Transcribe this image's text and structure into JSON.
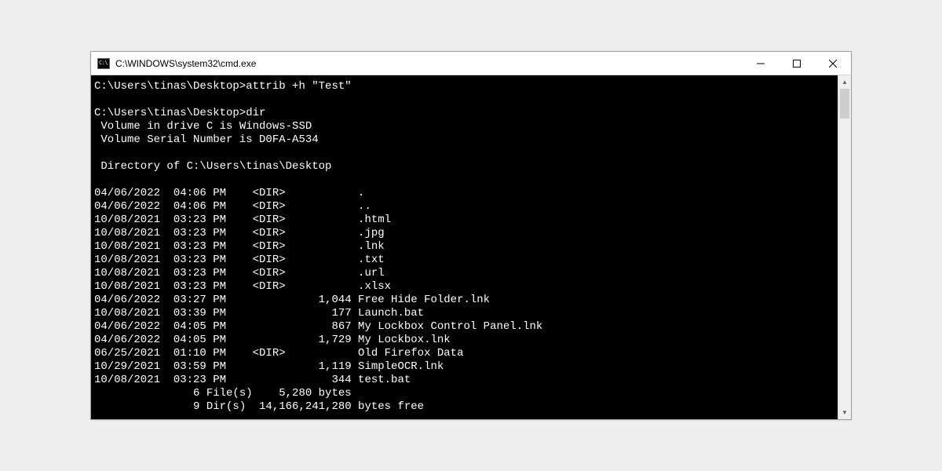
{
  "window": {
    "title": "C:\\WINDOWS\\system32\\cmd.exe"
  },
  "prompt_path": "C:\\Users\\tinas\\Desktop>",
  "commands": {
    "attrib": "attrib +h \"Test\"",
    "dir": "dir"
  },
  "dir_output": {
    "volume_line": " Volume in drive C is Windows-SSD",
    "serial_line": " Volume Serial Number is D0FA-A534",
    "directory_of": " Directory of C:\\Users\\tinas\\Desktop",
    "entries": [
      {
        "date": "04/06/2022",
        "time": "04:06 PM",
        "dir": true,
        "size": "",
        "name": "."
      },
      {
        "date": "04/06/2022",
        "time": "04:06 PM",
        "dir": true,
        "size": "",
        "name": ".."
      },
      {
        "date": "10/08/2021",
        "time": "03:23 PM",
        "dir": true,
        "size": "",
        "name": ".html"
      },
      {
        "date": "10/08/2021",
        "time": "03:23 PM",
        "dir": true,
        "size": "",
        "name": ".jpg"
      },
      {
        "date": "10/08/2021",
        "time": "03:23 PM",
        "dir": true,
        "size": "",
        "name": ".lnk"
      },
      {
        "date": "10/08/2021",
        "time": "03:23 PM",
        "dir": true,
        "size": "",
        "name": ".txt"
      },
      {
        "date": "10/08/2021",
        "time": "03:23 PM",
        "dir": true,
        "size": "",
        "name": ".url"
      },
      {
        "date": "10/08/2021",
        "time": "03:23 PM",
        "dir": true,
        "size": "",
        "name": ".xlsx"
      },
      {
        "date": "04/06/2022",
        "time": "03:27 PM",
        "dir": false,
        "size": "1,044",
        "name": "Free Hide Folder.lnk"
      },
      {
        "date": "10/08/2021",
        "time": "03:39 PM",
        "dir": false,
        "size": "177",
        "name": "Launch.bat"
      },
      {
        "date": "04/06/2022",
        "time": "04:05 PM",
        "dir": false,
        "size": "867",
        "name": "My Lockbox Control Panel.lnk"
      },
      {
        "date": "04/06/2022",
        "time": "04:05 PM",
        "dir": false,
        "size": "1,729",
        "name": "My Lockbox.lnk"
      },
      {
        "date": "06/25/2021",
        "time": "01:10 PM",
        "dir": true,
        "size": "",
        "name": "Old Firefox Data"
      },
      {
        "date": "10/29/2021",
        "time": "03:59 PM",
        "dir": false,
        "size": "1,119",
        "name": "SimpleOCR.lnk"
      },
      {
        "date": "10/08/2021",
        "time": "03:23 PM",
        "dir": false,
        "size": "344",
        "name": "test.bat"
      }
    ],
    "summary_files": {
      "count": "6",
      "label": "File(s)",
      "bytes": "5,280 bytes"
    },
    "summary_dirs": {
      "count": "9",
      "label": "Dir(s)",
      "bytes": "14,166,241,280 bytes free"
    }
  }
}
